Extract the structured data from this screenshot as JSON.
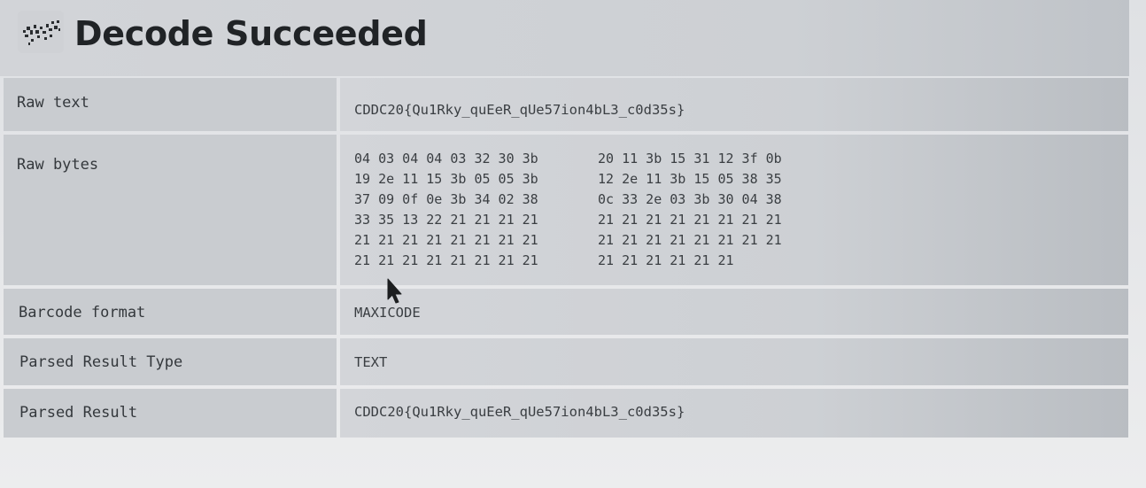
{
  "header": {
    "title": "Decode Succeeded",
    "logo_icon": "barcode-logo-icon"
  },
  "rows": {
    "raw_text": {
      "label": "Raw text",
      "value": "CDDC20{Qu1Rky_quEeR_qUe57ion4bL3_c0d35s}"
    },
    "raw_bytes": {
      "label": "Raw bytes",
      "lines": [
        {
          "left": "04 03 04 04 03 32 30 3b",
          "right": "20 11 3b 15 31 12 3f 0b"
        },
        {
          "left": "19 2e 11 15 3b 05 05 3b",
          "right": "12 2e 11 3b 15 05 38 35"
        },
        {
          "left": "37 09 0f 0e 3b 34 02 38",
          "right": "0c 33 2e 03 3b 30 04 38"
        },
        {
          "left": "33 35 13 22 21 21 21 21",
          "right": "21 21 21 21 21 21 21 21"
        },
        {
          "left": "21 21 21 21 21 21 21 21",
          "right": "21 21 21 21 21 21 21 21"
        },
        {
          "left": "21 21 21 21 21 21 21 21",
          "right": "21 21 21 21 21 21"
        }
      ]
    },
    "barcode_format": {
      "label": "Barcode format",
      "value": "MAXICODE"
    },
    "parsed_result_type": {
      "label": "Parsed Result Type",
      "value": "TEXT"
    },
    "parsed_result": {
      "label": "Parsed Result",
      "value": "CDDC20{Qu1Rky_quEeR_qUe57ion4bL3_c0d35s}"
    }
  },
  "cursor_icon": "mouse-pointer-icon",
  "colors": {
    "title": "#202326",
    "label_bg": "#c9ccd0",
    "value_bg": "#d3d5d9"
  }
}
